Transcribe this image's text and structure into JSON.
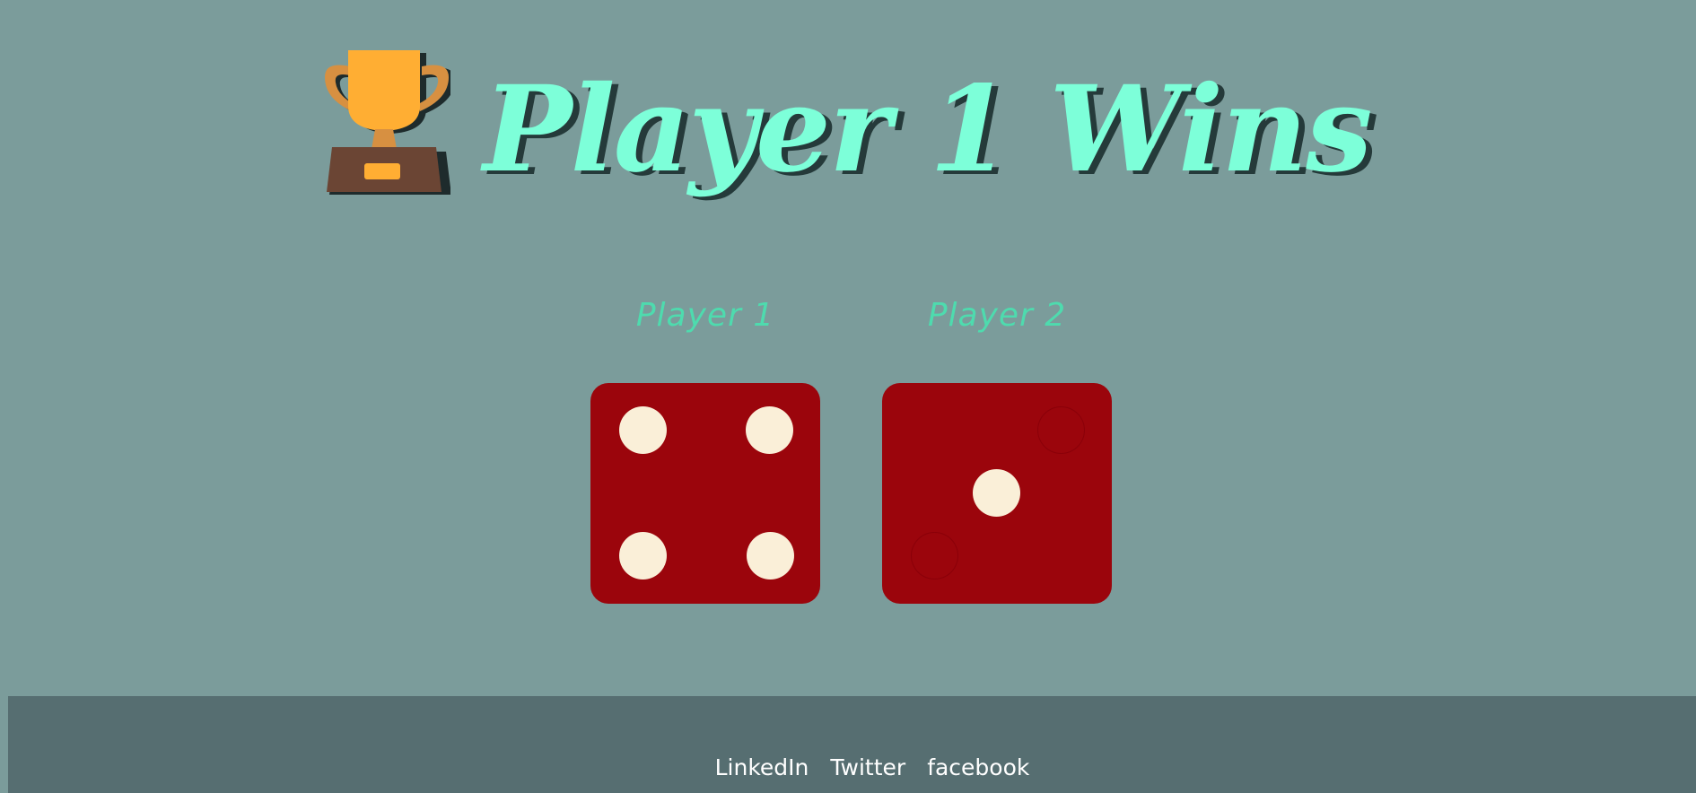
{
  "header": {
    "title": "Player 1 Wins",
    "icon": "trophy-icon"
  },
  "players": [
    {
      "label": "Player 1",
      "die_value": 4
    },
    {
      "label": "Player 2",
      "die_value": 1
    }
  ],
  "footer": {
    "links": [
      "LinkedIn",
      "Twitter",
      "facebook"
    ]
  },
  "colors": {
    "background": "#7b9c9b",
    "title": "#7dffd9",
    "player_label": "#4edbae",
    "die": "#9b050c",
    "pip": "#faefd8",
    "footer": "#566e71"
  }
}
